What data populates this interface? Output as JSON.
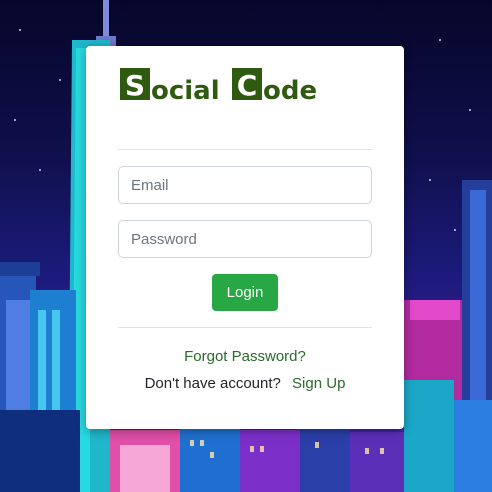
{
  "logo": {
    "text_part1": "Social",
    "text_part2": "Code",
    "color": "#2f5a10"
  },
  "form": {
    "email_placeholder": "Email",
    "password_placeholder": "Password",
    "login_label": "Login"
  },
  "links": {
    "forgot_password": "Forgot Password?",
    "no_account_text": "Don't have account?",
    "sign_up": "Sign Up"
  },
  "colors": {
    "primary_button": "#28a745",
    "link": "#2a6a2a",
    "card": "#ffffff"
  }
}
